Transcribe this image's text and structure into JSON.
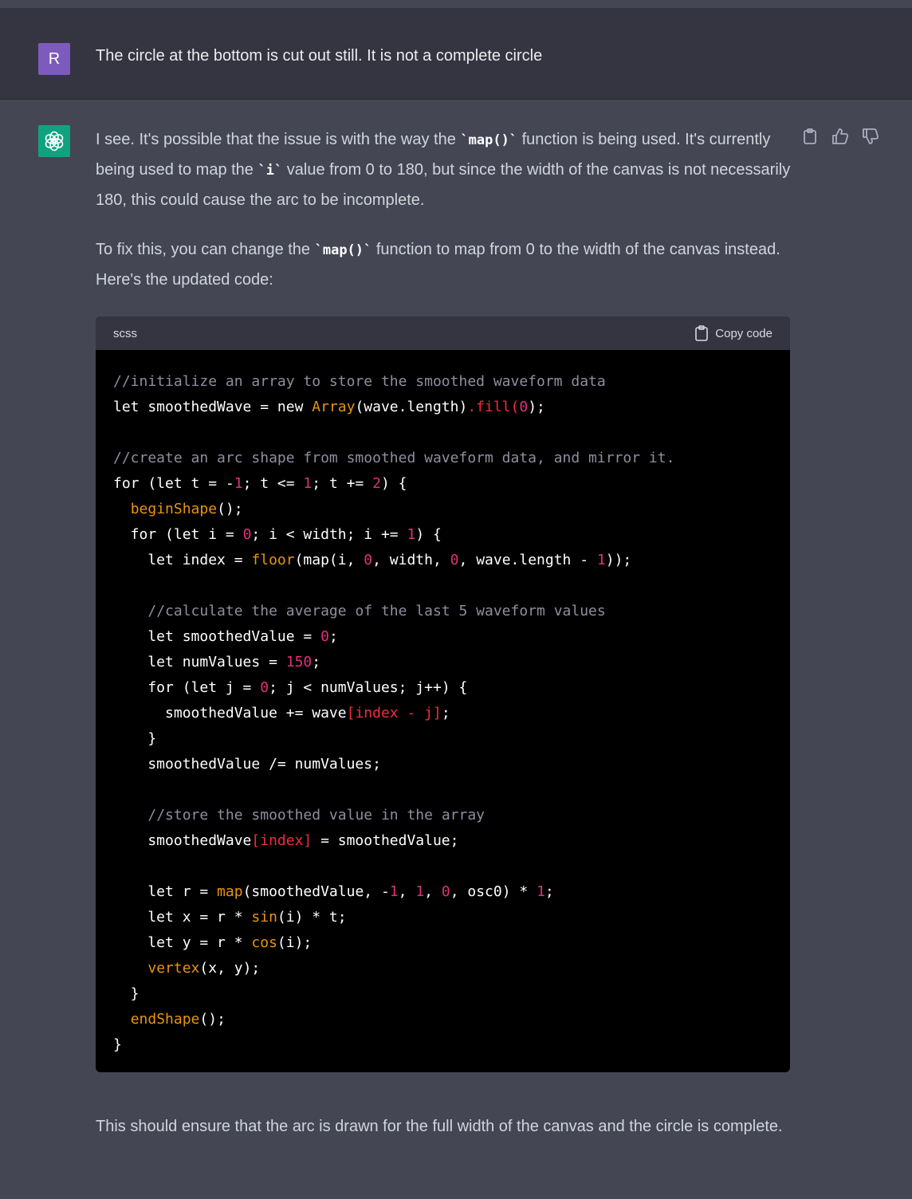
{
  "user_message": {
    "avatar_letter": "R",
    "text": "The circle at the bottom is cut out still. It is not a complete circle"
  },
  "assistant_message": {
    "paragraph1": {
      "a": "I see. It's possible that the issue is with the way the ",
      "code1": "`map()`",
      "b": " function is being used. It's currently being used to map the ",
      "code2": "`i`",
      "c": " value from 0 to 180, but since the width of the canvas is not necessarily 180, this could cause the arc to be incomplete."
    },
    "paragraph2": {
      "a": "To fix this, you can change the ",
      "code1": "`map()`",
      "b": " function to map from 0 to the width of the canvas instead. Here's the updated code:"
    },
    "code_block": {
      "language": "scss",
      "copy_label": "Copy code"
    },
    "paragraph3": "This should ensure that the arc is drawn for the full width of the canvas and the circle is complete."
  },
  "action_icons": [
    "clipboard-icon",
    "thumbs-up-icon",
    "thumbs-down-icon"
  ],
  "colors": {
    "user_bg": "#343541",
    "assistant_bg": "#444654",
    "user_avatar": "#7d5bbd",
    "bot_avatar": "#10a37f",
    "code_bg": "#000000",
    "comment": "#8e8ea0",
    "number": "#df3079",
    "function": "#e9950c"
  }
}
